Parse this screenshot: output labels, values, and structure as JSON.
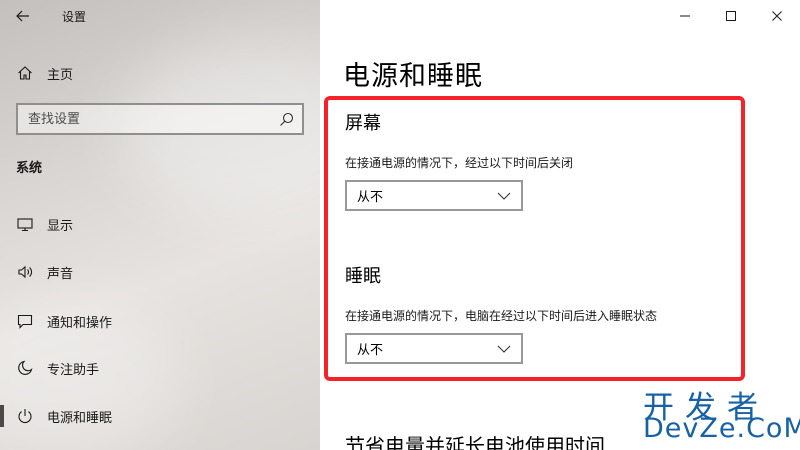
{
  "window": {
    "title": "设置",
    "controls": [
      "minimize-icon",
      "maximize-icon",
      "close-icon"
    ]
  },
  "sidebar": {
    "home_label": "主页",
    "search": {
      "placeholder": "查找设置",
      "value": ""
    },
    "section_label": "系统",
    "items": [
      {
        "label": "显示",
        "icon": "display-icon"
      },
      {
        "label": "声音",
        "icon": "sound-icon"
      },
      {
        "label": "通知和操作",
        "icon": "notification-icon"
      },
      {
        "label": "专注助手",
        "icon": "moon-icon"
      },
      {
        "label": "电源和睡眠",
        "icon": "power-icon",
        "active": true
      }
    ]
  },
  "main": {
    "title": "电源和睡眠",
    "screen": {
      "title": "屏幕",
      "description": "在接通电源的情况下，经过以下时间后关闭",
      "selected": "从不"
    },
    "sleep": {
      "title": "睡眠",
      "description": "在接通电源的情况下，电脑在经过以下时间后进入睡眠状态",
      "selected": "从不"
    },
    "next_heading": "节省电量并延长电池使用时间"
  },
  "highlight_color": "#f5222a",
  "watermark": {
    "line1": "开发者",
    "line2": "DevZe.CoM",
    "color": "#1761a5"
  }
}
